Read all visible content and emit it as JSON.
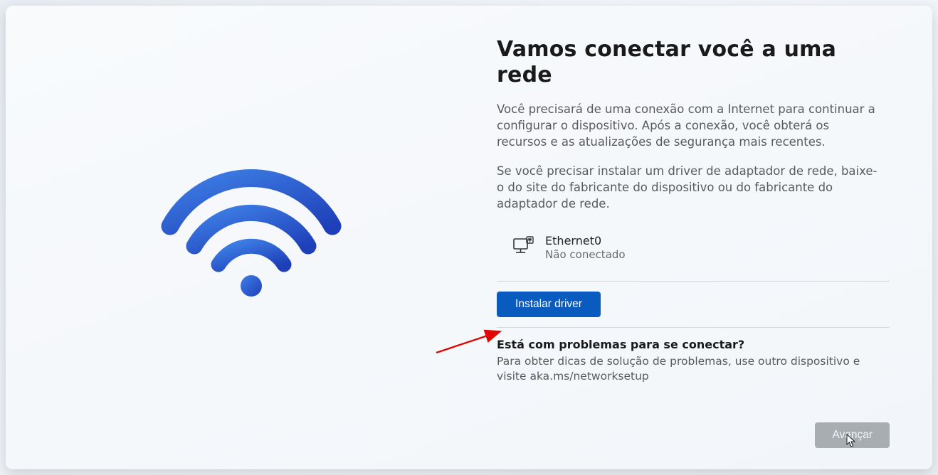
{
  "heading": "Vamos conectar você a uma rede",
  "para1": "Você precisará de uma conexão com a Internet para continuar a configurar o dispositivo. Após a conexão, você obterá os recursos e as atualizações de segurança mais recentes.",
  "para2": "Se você precisar instalar um driver de adaptador de rede, baixe-o do site do fabricante do dispositivo ou do fabricante do adaptador de rede.",
  "network": {
    "name": "Ethernet0",
    "status": "Não conectado"
  },
  "buttons": {
    "install_driver": "Instalar driver",
    "next": "Avançar"
  },
  "trouble": {
    "question": "Está com problemas para se conectar?",
    "answer": "Para obter dicas de solução de problemas, use outro dispositivo e visite aka.ms/networksetup"
  }
}
